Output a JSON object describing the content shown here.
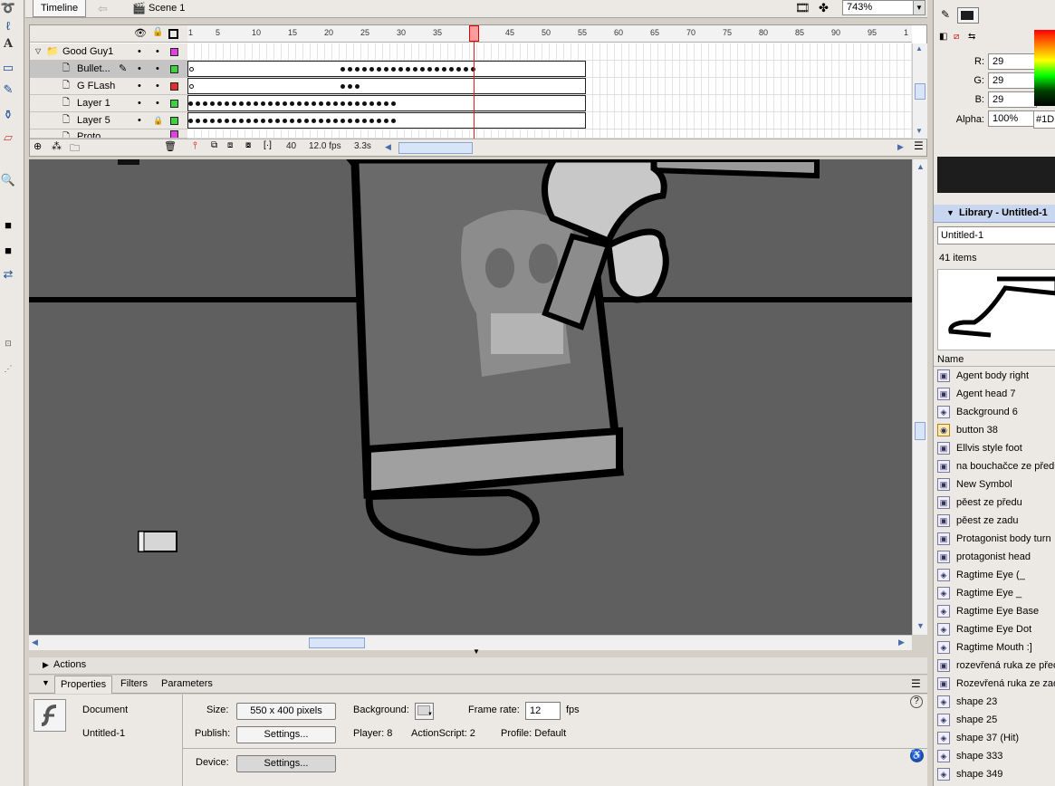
{
  "timeline": {
    "tab_label": "Timeline",
    "scene_label": "Scene 1",
    "zoom": "743%",
    "ruler_ticks": [
      "1",
      "5",
      "10",
      "15",
      "20",
      "25",
      "30",
      "35",
      "40",
      "45",
      "50",
      "55",
      "60",
      "65",
      "70",
      "75",
      "80",
      "85",
      "90",
      "95",
      "1"
    ],
    "layers": [
      {
        "name": "Good Guy1",
        "type": "folder",
        "color": "#e040e0"
      },
      {
        "name": "Bullet...",
        "type": "layer",
        "color": "#40d040"
      },
      {
        "name": "G FLash",
        "type": "layer",
        "color": "#e03030"
      },
      {
        "name": "Layer 1",
        "type": "layer",
        "color": "#40d040"
      },
      {
        "name": "Layer 5",
        "type": "layer",
        "color": "#40d040"
      },
      {
        "name": "Proto",
        "type": "layer",
        "color": "#e040e0"
      }
    ],
    "current_frame": "40",
    "frame_rate": "12.0 fps",
    "elapsed": "3.3s"
  },
  "actions": {
    "label": "Actions"
  },
  "properties": {
    "tabs": [
      "Properties",
      "Filters",
      "Parameters"
    ],
    "doc_type": "Document",
    "doc_name": "Untitled-1",
    "size_label": "Size:",
    "size_value": "550 x 400 pixels",
    "background_label": "Background:",
    "frame_rate_label": "Frame rate:",
    "frame_rate_value": "12",
    "fps_label": "fps",
    "publish_label": "Publish:",
    "settings_label": "Settings...",
    "player": "Player: 8",
    "actionscript": "ActionScript:  2",
    "profile": "Profile:  Default",
    "device_label": "Device:"
  },
  "color": {
    "r_label": "R:",
    "r": "29",
    "g_label": "G:",
    "g": "29",
    "b_label": "B:",
    "b": "29",
    "alpha_label": "Alpha:",
    "alpha": "100%",
    "hex": "#1D",
    "swatch": "#1d1d1d"
  },
  "library": {
    "title": "Library - Untitled-1",
    "doc": "Untitled-1",
    "count": "41 items",
    "name_header": "Name",
    "items": [
      {
        "name": "Agent body right",
        "icon": "graphic"
      },
      {
        "name": "Agent head 7",
        "icon": "graphic"
      },
      {
        "name": "Background 6",
        "icon": "movieclip"
      },
      {
        "name": "button 38",
        "icon": "button"
      },
      {
        "name": "Ellvis style foot",
        "icon": "graphic"
      },
      {
        "name": "na bouchačce ze předu",
        "icon": "graphic"
      },
      {
        "name": "New Symbol",
        "icon": "graphic"
      },
      {
        "name": "pěest ze předu",
        "icon": "graphic"
      },
      {
        "name": "pěest ze zadu",
        "icon": "graphic"
      },
      {
        "name": "Protagonist body turn",
        "icon": "graphic"
      },
      {
        "name": "protagonist head",
        "icon": "graphic"
      },
      {
        "name": "Ragtime Eye (_",
        "icon": "movieclip"
      },
      {
        "name": "Ragtime Eye _",
        "icon": "movieclip"
      },
      {
        "name": "Ragtime Eye Base",
        "icon": "movieclip"
      },
      {
        "name": "Ragtime Eye Dot",
        "icon": "movieclip"
      },
      {
        "name": "Ragtime Mouth :]",
        "icon": "movieclip"
      },
      {
        "name": "rozevřená ruka ze předu",
        "icon": "graphic"
      },
      {
        "name": "Rozevřená ruka ze zadu",
        "icon": "graphic"
      },
      {
        "name": "shape 23",
        "icon": "movieclip"
      },
      {
        "name": "shape 25",
        "icon": "movieclip"
      },
      {
        "name": "shape 37 (Hit)",
        "icon": "movieclip"
      },
      {
        "name": "shape 333",
        "icon": "movieclip"
      },
      {
        "name": "shape 349",
        "icon": "movieclip"
      }
    ]
  }
}
